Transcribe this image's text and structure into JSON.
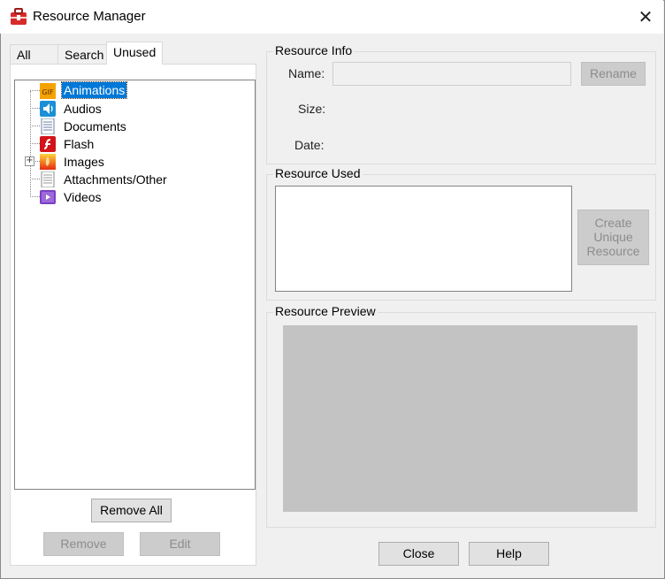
{
  "window": {
    "title": "Resource Manager",
    "close_glyph": "✕"
  },
  "tabs": [
    {
      "label": "All"
    },
    {
      "label": "Search"
    },
    {
      "label": "Unused"
    }
  ],
  "tree": {
    "expander_glyph": "+",
    "items": [
      {
        "label": "Animations",
        "icon": "gif-icon",
        "selected": true
      },
      {
        "label": "Audios",
        "icon": "speaker-icon"
      },
      {
        "label": "Documents",
        "icon": "document-icon"
      },
      {
        "label": "Flash",
        "icon": "flash-icon"
      },
      {
        "label": "Images",
        "icon": "image-icon",
        "expandable": true
      },
      {
        "label": "Attachments/Other",
        "icon": "attachment-icon"
      },
      {
        "label": "Videos",
        "icon": "video-icon"
      }
    ]
  },
  "left_buttons": {
    "remove_all": "Remove All",
    "remove": "Remove",
    "edit": "Edit"
  },
  "resource_info": {
    "title": "Resource Info",
    "name_label": "Name:",
    "name_value": "",
    "size_label": "Size:",
    "date_label": "Date:",
    "rename_label": "Rename"
  },
  "resource_used": {
    "title": "Resource Used",
    "create_line1": "Create",
    "create_line2": "Unique",
    "create_line3": "Resource"
  },
  "resource_preview": {
    "title": "Resource Preview"
  },
  "footer": {
    "close_label": "Close",
    "help_label": "Help"
  },
  "icon_text": {
    "gif": "GIF"
  },
  "colors": {
    "selection": "#0078d7",
    "preview_bg": "#c3c3c3"
  }
}
